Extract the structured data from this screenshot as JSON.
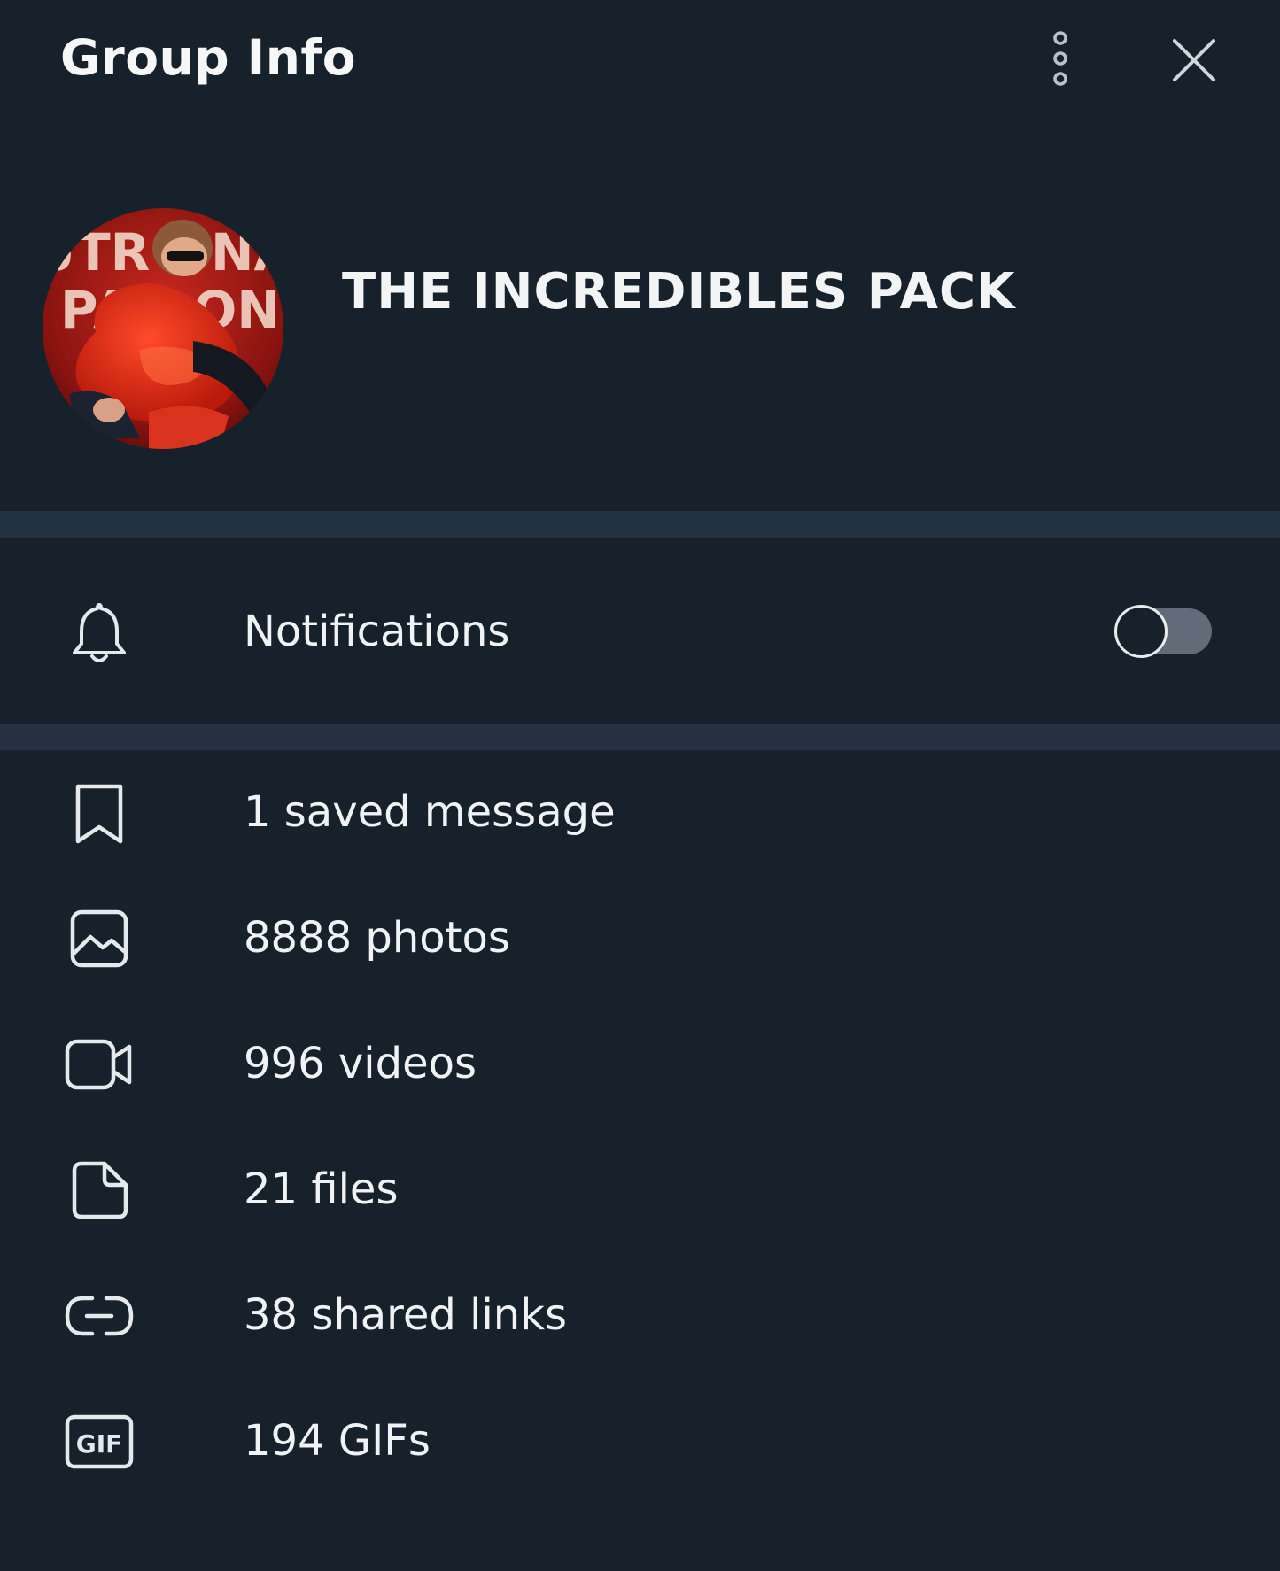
{
  "header": {
    "title": "Group Info"
  },
  "profile": {
    "group_name": "THE INCREDIBLES PACK",
    "avatar_text": "OUTR NA PA ON"
  },
  "notifications": {
    "label": "Notifications",
    "enabled": false
  },
  "media": [
    {
      "icon": "bookmark-icon",
      "label": "1 saved message"
    },
    {
      "icon": "photo-icon",
      "label": "8888 photos"
    },
    {
      "icon": "video-icon",
      "label": "996 videos"
    },
    {
      "icon": "file-icon",
      "label": "21 files"
    },
    {
      "icon": "link-icon",
      "label": "38 shared links"
    },
    {
      "icon": "gif-icon",
      "label": "194 GIFs"
    }
  ],
  "colors": {
    "background": "#17212b",
    "divider": "#243140",
    "text": "#f0f3f6",
    "toggle_track": "#626c78"
  }
}
